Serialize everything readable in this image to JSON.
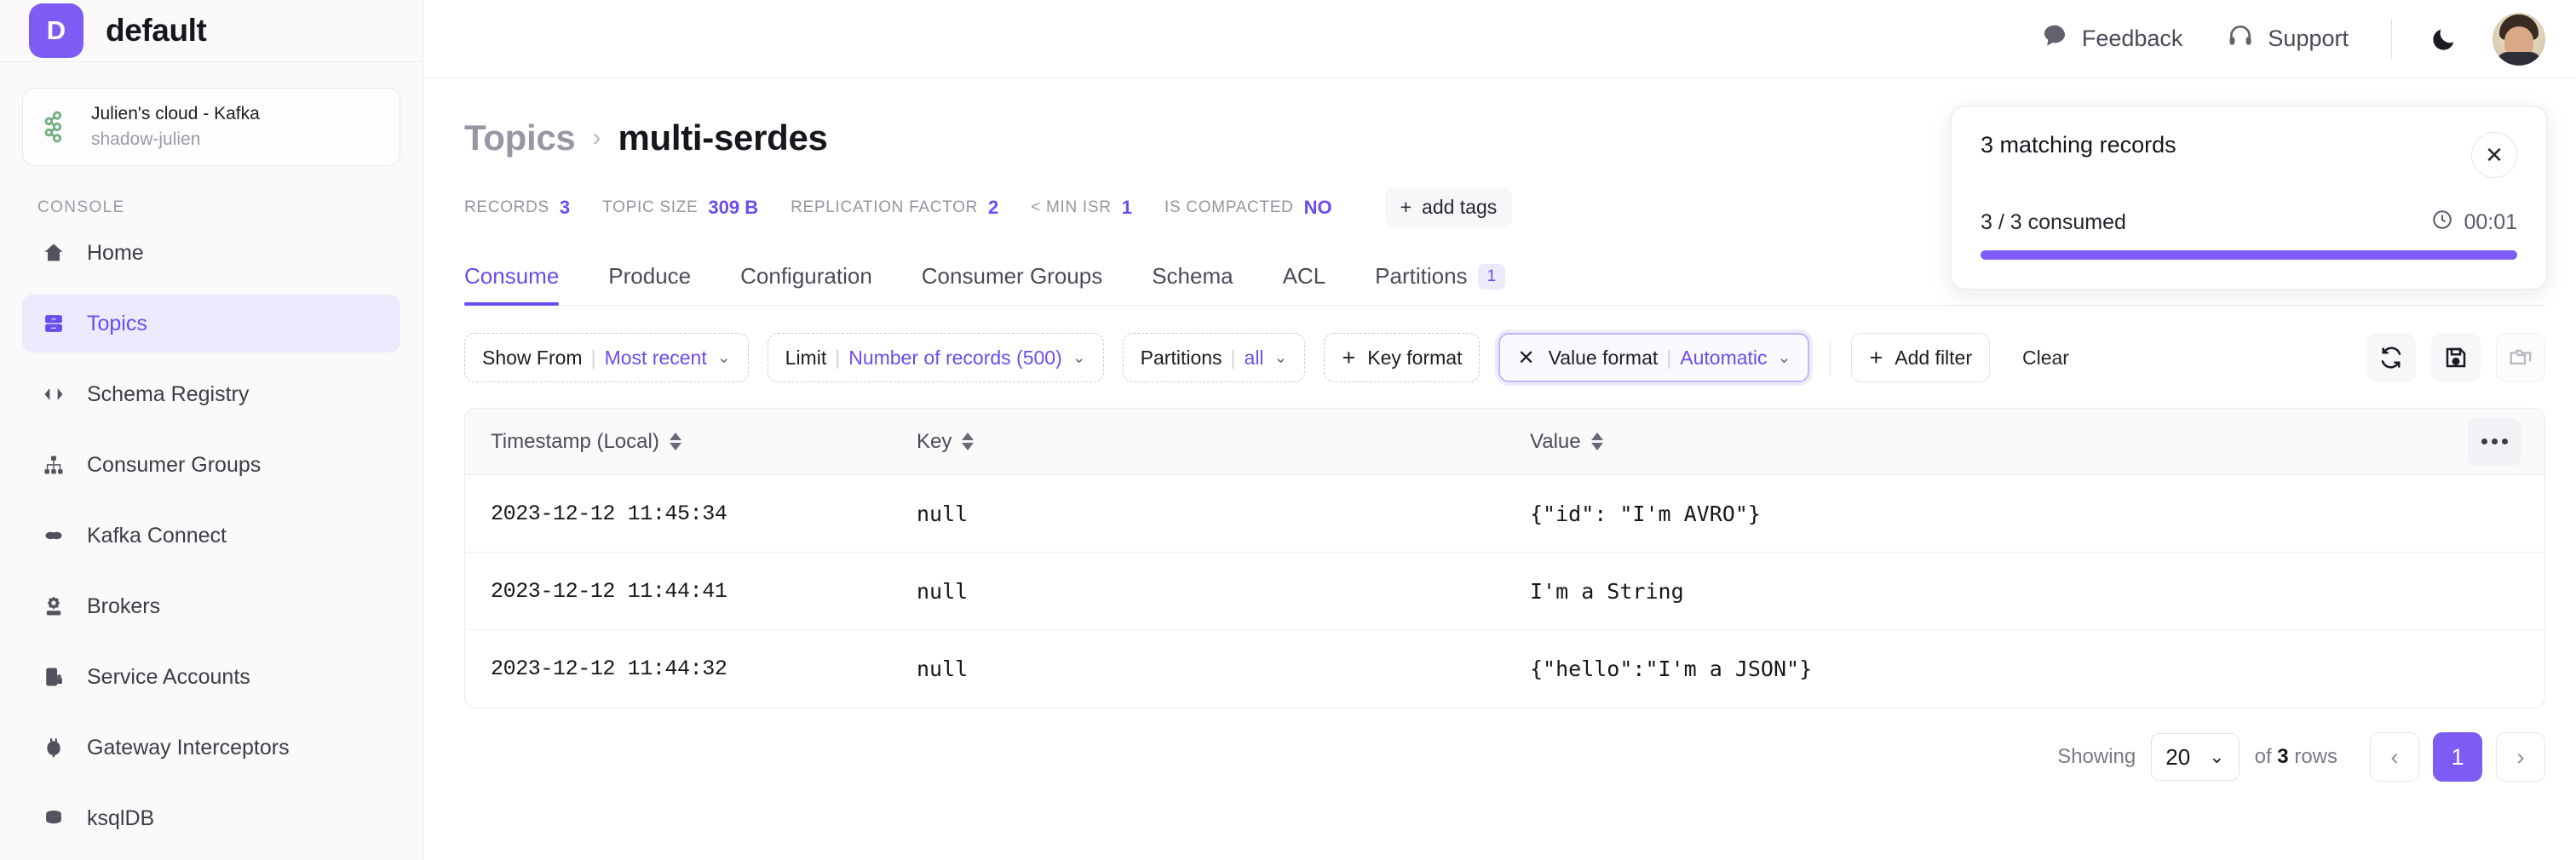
{
  "sidebar": {
    "brand": {
      "initial": "D",
      "title": "default"
    },
    "cluster": {
      "icon": "kafka-icon",
      "name": "Julien's cloud - Kafka",
      "sub": "shadow-julien"
    },
    "section_label": "CONSOLE",
    "items": [
      {
        "label": "Home",
        "icon": "home-icon",
        "active": false
      },
      {
        "label": "Topics",
        "icon": "topics-icon",
        "active": true
      },
      {
        "label": "Schema Registry",
        "icon": "code-brackets-icon",
        "active": false
      },
      {
        "label": "Consumer Groups",
        "icon": "sitemap-icon",
        "active": false
      },
      {
        "label": "Kafka Connect",
        "icon": "link-icon",
        "active": false
      },
      {
        "label": "Brokers",
        "icon": "server-gear-icon",
        "active": false
      },
      {
        "label": "Service Accounts",
        "icon": "device-lock-icon",
        "active": false
      },
      {
        "label": "Gateway Interceptors",
        "icon": "plug-icon",
        "active": false
      },
      {
        "label": "ksqlDB",
        "icon": "database-icon",
        "active": false
      }
    ]
  },
  "topbar": {
    "feedback_label": "Feedback",
    "feedback_icon": "chat-bubble-icon",
    "support_label": "Support",
    "support_icon": "headset-icon",
    "theme_toggle_icon": "moon-icon",
    "avatar_icon": "avatar"
  },
  "header": {
    "breadcrumb_parent": "Topics",
    "breadcrumb_sep": "›",
    "breadcrumb_current": "multi-serdes",
    "stats": [
      {
        "key": "RECORDS",
        "value": "3"
      },
      {
        "key": "TOPIC SIZE",
        "value": "309 B"
      },
      {
        "key": "REPLICATION FACTOR",
        "value": "2"
      },
      {
        "key": "< MIN ISR",
        "value": "1"
      },
      {
        "key": "IS COMPACTED",
        "value": "NO"
      }
    ],
    "add_tags_label": "add tags",
    "add_tags_icon": "plus-icon"
  },
  "tabs": [
    {
      "label": "Consume",
      "active": true,
      "badge": ""
    },
    {
      "label": "Produce",
      "active": false,
      "badge": ""
    },
    {
      "label": "Configuration",
      "active": false,
      "badge": ""
    },
    {
      "label": "Consumer Groups",
      "active": false,
      "badge": ""
    },
    {
      "label": "Schema",
      "active": false,
      "badge": ""
    },
    {
      "label": "ACL",
      "active": false,
      "badge": ""
    },
    {
      "label": "Partitions",
      "active": false,
      "badge": "1"
    }
  ],
  "filters": {
    "show_from": {
      "label": "Show From",
      "value": "Most recent"
    },
    "limit": {
      "label": "Limit",
      "value": "Number of records (500)"
    },
    "partitions": {
      "label": "Partitions",
      "value": "all"
    },
    "key_format": {
      "label": "Key format",
      "icon": "plus-icon"
    },
    "value_format": {
      "label": "Value format",
      "value": "Automatic",
      "icon": "close-icon"
    },
    "add_filter": {
      "label": "Add filter",
      "icon": "plus-icon"
    },
    "clear": {
      "label": "Clear"
    },
    "actions": [
      {
        "name": "refresh-icon"
      },
      {
        "name": "save-icon"
      },
      {
        "name": "folders-icon"
      }
    ]
  },
  "table": {
    "columns": [
      {
        "label": "Timestamp (Local)",
        "sortable": true
      },
      {
        "label": "Key",
        "sortable": true
      },
      {
        "label": "Value",
        "sortable": true
      }
    ],
    "menu_icon": "more-options-icon",
    "rows": [
      {
        "timestamp": "2023-12-12 11:45:34",
        "key": "null",
        "value": "{\"id\": \"I'm AVRO\"}"
      },
      {
        "timestamp": "2023-12-12 11:44:41",
        "key": "null",
        "value": "I'm a String"
      },
      {
        "timestamp": "2023-12-12 11:44:32",
        "key": "null",
        "value": "{\"hello\":\"I'm a JSON\"}"
      }
    ]
  },
  "pagination": {
    "showing_label": "Showing",
    "page_size": "20",
    "of_label": "of",
    "total": "3",
    "rows_label": "rows",
    "prev_icon": "chevron-left-icon",
    "next_icon": "chevron-right-icon",
    "current_page": "1"
  },
  "toast": {
    "title": "3 matching records",
    "consumed": "3 / 3 consumed",
    "timer": "00:01",
    "timer_icon": "clock-icon",
    "close_icon": "close-icon",
    "progress_percent": 100
  },
  "colors": {
    "accent": "#6a4df0",
    "accent_solid": "#7c5cf5",
    "accent_soft": "#ecebfd",
    "sidebar_bg": "#fafafa",
    "border": "#ececf0",
    "text": "#16161d",
    "muted": "#9a9aa6"
  }
}
